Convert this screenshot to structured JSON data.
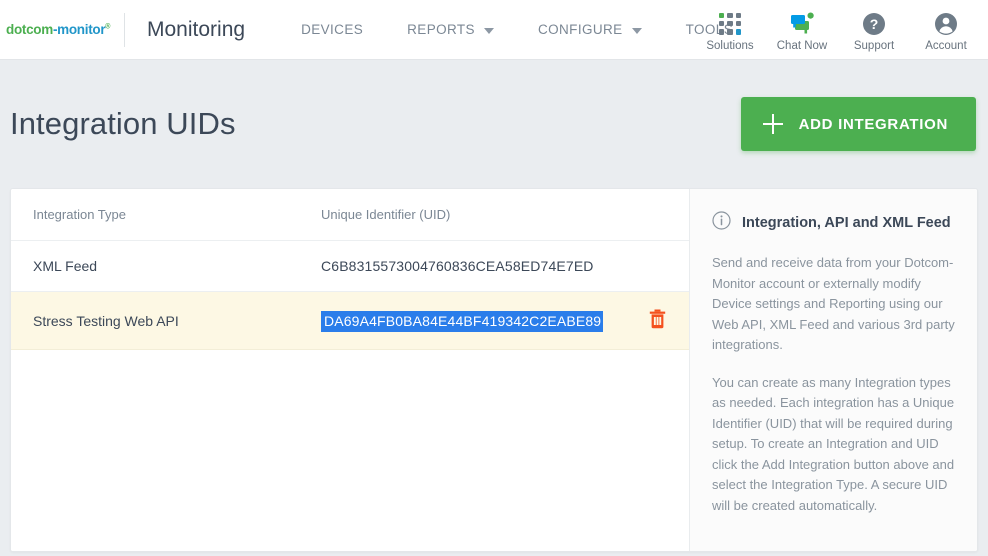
{
  "brand": {
    "logo_green": "dotcom",
    "logo_blue": "-monitor",
    "logo_mark": "®"
  },
  "header": {
    "app_title": "Monitoring",
    "nav_items": [
      {
        "label": "DEVICES",
        "has_caret": false
      },
      {
        "label": "REPORTS",
        "has_caret": true
      },
      {
        "label": "CONFIGURE",
        "has_caret": true
      },
      {
        "label": "TOOLS",
        "has_caret": false
      }
    ],
    "tools": [
      {
        "label": "Solutions",
        "icon": "apps-grid-icon"
      },
      {
        "label": "Chat Now",
        "icon": "chat-bubble-icon"
      },
      {
        "label": "Support",
        "icon": "question-circle-icon"
      },
      {
        "label": "Account",
        "icon": "user-circle-icon"
      }
    ]
  },
  "page": {
    "title": "Integration UIDs",
    "add_button_label": "ADD INTEGRATION"
  },
  "table": {
    "columns": [
      "Integration Type",
      "Unique Identifier (UID)",
      ""
    ],
    "rows": [
      {
        "type": "XML Feed",
        "uid": "C6B8315573004760836CEA58ED74E7ED",
        "selected": false,
        "highlighted": false,
        "has_delete": false
      },
      {
        "type": "Stress Testing Web API",
        "uid": "DA69A4FB0BA84E44BF419342C2EABE89",
        "selected": true,
        "highlighted": true,
        "has_delete": true
      }
    ]
  },
  "info_panel": {
    "title": "Integration, API and XML Feed",
    "paragraph_1": "Send and receive data from your Dotcom-Monitor account or externally modify Device settings and Reporting using our Web API, XML Feed and various 3rd party integrations.",
    "paragraph_2": "You can create as many Integration types as needed. Each integration has a Unique Identifier (UID) that will be required during setup. To create an Integration and UID click the Add Integration button above and select the Integration Type. A secure UID will be created automatically."
  },
  "colors": {
    "brand_green": "#4caf50",
    "brand_blue": "#2196c9",
    "page_bg": "#eaedf0",
    "row_highlight": "#fdf8e4",
    "selection_blue": "#2a7dea",
    "delete_orange": "#f4511e",
    "text_dark": "#3c4858",
    "text_muted": "#8a949e"
  }
}
